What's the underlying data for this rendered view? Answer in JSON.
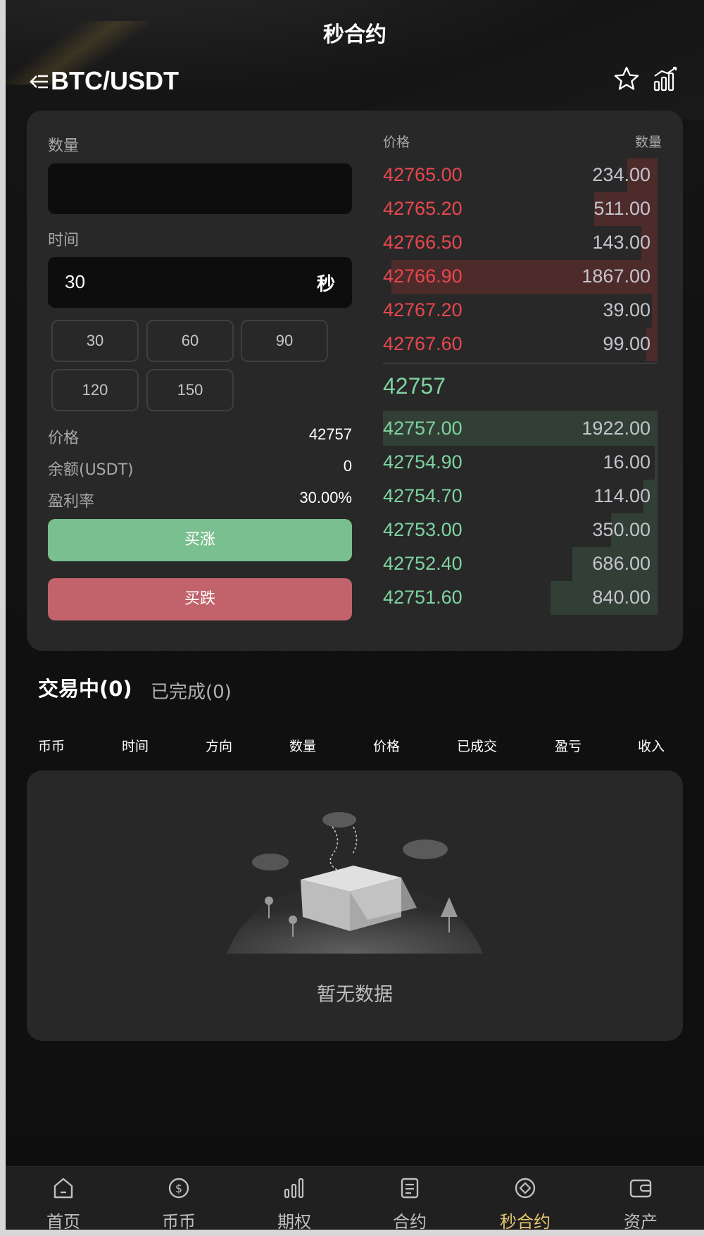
{
  "header": {
    "title": "秒合约",
    "pair": "BTC/USDT",
    "icons": [
      "back-icon",
      "star-icon",
      "chart-icon"
    ]
  },
  "trade": {
    "quantity_label": "数量",
    "quantity_value": "",
    "time_label": "时间",
    "time_value": "30",
    "time_unit": "秒",
    "time_options": [
      "30",
      "60",
      "90",
      "120",
      "150"
    ],
    "price_label": "价格",
    "price_value": "42757",
    "balance_label": "余额(USDT)",
    "balance_value": "0",
    "profit_label": "盈利率",
    "profit_value": "30.00%",
    "buy_up_label": "买涨",
    "buy_down_label": "买跌",
    "up_color": "#79bf8f",
    "down_color": "#c2636b"
  },
  "orderbook": {
    "price_header": "价格",
    "qty_header": "数量",
    "asks": [
      {
        "price": "42765.00",
        "qty": "234.00",
        "depth": 0.11
      },
      {
        "price": "42765.20",
        "qty": "511.00",
        "depth": 0.23
      },
      {
        "price": "42766.50",
        "qty": "143.00",
        "depth": 0.06
      },
      {
        "price": "42766.90",
        "qty": "1867.00",
        "depth": 0.97
      },
      {
        "price": "42767.20",
        "qty": "39.00",
        "depth": 0.02
      },
      {
        "price": "42767.60",
        "qty": "99.00",
        "depth": 0.04
      }
    ],
    "last_price": "42757",
    "bids": [
      {
        "price": "42757.00",
        "qty": "1922.00",
        "depth": 1.0
      },
      {
        "price": "42754.90",
        "qty": "16.00",
        "depth": 0.01
      },
      {
        "price": "42754.70",
        "qty": "114.00",
        "depth": 0.05
      },
      {
        "price": "42753.00",
        "qty": "350.00",
        "depth": 0.17
      },
      {
        "price": "42752.40",
        "qty": "686.00",
        "depth": 0.31
      },
      {
        "price": "42751.60",
        "qty": "840.00",
        "depth": 0.39
      }
    ],
    "ask_color": "#e8474e",
    "bid_color": "#7ed3a0"
  },
  "orders": {
    "tab_active": "交易中(0)",
    "tab_done": "已完成(0)",
    "columns": [
      "币币",
      "时间",
      "方向",
      "数量",
      "价格",
      "已成交",
      "盈亏",
      "收入"
    ],
    "empty_text": "暂无数据"
  },
  "nav": {
    "items": [
      {
        "label": "首页",
        "icon": "home-icon"
      },
      {
        "label": "币币",
        "icon": "coin-icon"
      },
      {
        "label": "期权",
        "icon": "bars-icon"
      },
      {
        "label": "合约",
        "icon": "document-icon"
      },
      {
        "label": "秒合约",
        "icon": "diamond-icon",
        "active": true
      },
      {
        "label": "资产",
        "icon": "wallet-icon"
      }
    ],
    "active_color": "#e6c56f"
  }
}
